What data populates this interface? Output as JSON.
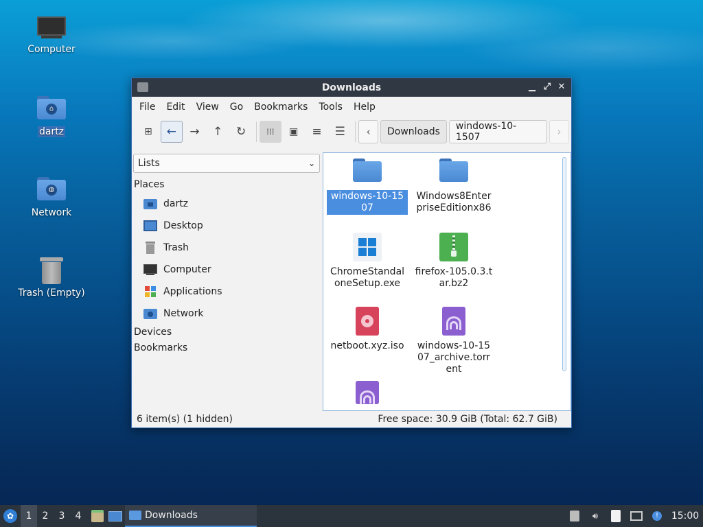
{
  "desktop": {
    "icons": [
      {
        "label": "Computer",
        "icon": "monitor-icon"
      },
      {
        "label": "dartz",
        "icon": "home-folder-icon"
      },
      {
        "label": "Network",
        "icon": "network-folder-icon"
      },
      {
        "label": "Trash (Empty)",
        "icon": "trash-icon"
      }
    ]
  },
  "window": {
    "title": "Downloads",
    "controls": {
      "minimize": "▁",
      "maximize": "⤢",
      "close": "✕"
    },
    "menu": [
      "File",
      "Edit",
      "View",
      "Go",
      "Bookmarks",
      "Tools",
      "Help"
    ],
    "toolbar": {
      "buttons": [
        "new-tab-icon",
        "back-icon",
        "forward-icon",
        "up-icon",
        "reload-icon",
        "icon-view-icon",
        "thumbnail-view-icon",
        "compact-view-icon",
        "detailed-view-icon"
      ],
      "breadcrumb": [
        "Downloads",
        "windows-10-1507"
      ]
    },
    "sidebar": {
      "mode": "Lists",
      "places_header": "Places",
      "places": [
        "dartz",
        "Desktop",
        "Trash",
        "Computer",
        "Applications",
        "Network"
      ],
      "devices_header": "Devices",
      "bookmarks_header": "Bookmarks"
    },
    "files": [
      {
        "name": "windows-10-1507",
        "type": "folder",
        "selected": true
      },
      {
        "name": "Windows8EnterpriseEditionx86",
        "type": "folder"
      },
      {
        "name": "ChromeStandaloneSetup.exe",
        "type": "exe"
      },
      {
        "name": "firefox-105.0.3.tar.bz2",
        "type": "archive"
      },
      {
        "name": "netboot.xyz.iso",
        "type": "iso"
      },
      {
        "name": "windows-10-1507_archive.torrent",
        "type": "torrent"
      },
      {
        "name": "",
        "type": "torrent"
      }
    ],
    "status": {
      "left": "6 item(s) (1 hidden)",
      "right": "Free space: 30.9 GiB (Total: 62.7 GiB)"
    }
  },
  "taskbar": {
    "workspaces": [
      "1",
      "2",
      "3",
      "4"
    ],
    "active_task": "Downloads",
    "clock": "15:00"
  },
  "colors": {
    "accent": "#4a8ee0",
    "titlebar": "#303843",
    "taskbar": "#2b333d"
  }
}
